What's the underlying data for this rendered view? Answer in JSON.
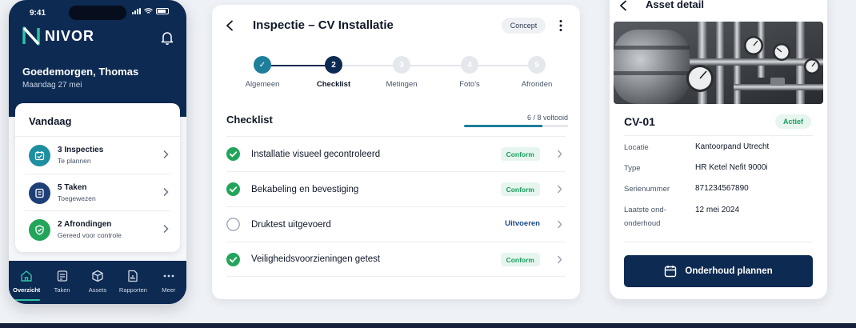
{
  "colors": {
    "navy": "#0d2a52",
    "teal": "#1e7f9c",
    "green": "#1b9c60",
    "green_bg": "#e6f6ee",
    "accent": "#2ec4a6"
  },
  "phone": {
    "status_time": "9:41",
    "brand": "NIVOR",
    "greeting": "Goedemorgen, Thomas",
    "date": "Maandag 27 mei",
    "today": {
      "title": "Vandaag",
      "items": [
        {
          "title": "3 Inspecties",
          "subtitle": "Te plannen",
          "icon": "calendar-check-icon",
          "color": "#1e8fa0"
        },
        {
          "title": "5 Taken",
          "subtitle": "Toegewezen",
          "icon": "task-list-icon",
          "color": "#1f3f77"
        },
        {
          "title": "2 Afrondingen",
          "subtitle": "Gereed voor controle",
          "icon": "check-shield-icon",
          "color": "#22a55a"
        }
      ]
    },
    "tabs": [
      {
        "label": "Overzicht",
        "icon": "home-icon",
        "active": true
      },
      {
        "label": "Taken",
        "icon": "tasks-icon",
        "active": false
      },
      {
        "label": "Assets",
        "icon": "box-icon",
        "active": false
      },
      {
        "label": "Rapporten",
        "icon": "report-icon",
        "active": false
      },
      {
        "label": "Meer",
        "icon": "more-icon",
        "active": false
      }
    ]
  },
  "inspection": {
    "title": "Inspectie – CV Installatie",
    "status_badge": "Concept",
    "steps": [
      {
        "number": "✓",
        "label": "Algemeen",
        "state": "done"
      },
      {
        "number": "2",
        "label": "Checklist",
        "state": "current"
      },
      {
        "number": "3",
        "label": "Metingen",
        "state": "todo"
      },
      {
        "number": "4",
        "label": "Foto's",
        "state": "todo"
      },
      {
        "number": "5",
        "label": "Afronden",
        "state": "todo"
      }
    ],
    "checklist_title": "Checklist",
    "progress_text": "6 / 8 voltooid",
    "progress_fraction": 0.75,
    "items": [
      {
        "label": "Installatie visueel gecontroleerd",
        "status": "Conform",
        "done": true
      },
      {
        "label": "Bekabeling en bevestiging",
        "status": "Conform",
        "done": true
      },
      {
        "label": "Druktest uitgevoerd",
        "status": "Uitvoeren",
        "done": false
      },
      {
        "label": "Veiligheidsvoorzieningen getest",
        "status": "Conform",
        "done": true
      }
    ]
  },
  "asset": {
    "header_title": "Asset detail",
    "photo_icon": "boiler-gauges-photo",
    "name": "CV-01",
    "status": "Actief",
    "properties": [
      {
        "label": "Locatie",
        "value": "Kantoorpand Utrecht"
      },
      {
        "label": "Type",
        "value": "HR Ketel Nefit 9000i"
      },
      {
        "label": "Serienummer",
        "value": "871234567890"
      },
      {
        "label": "Laatste ond-\nonderhoud",
        "value": "12 mei 2024"
      }
    ],
    "button_label": "Onderhoud plannen"
  }
}
